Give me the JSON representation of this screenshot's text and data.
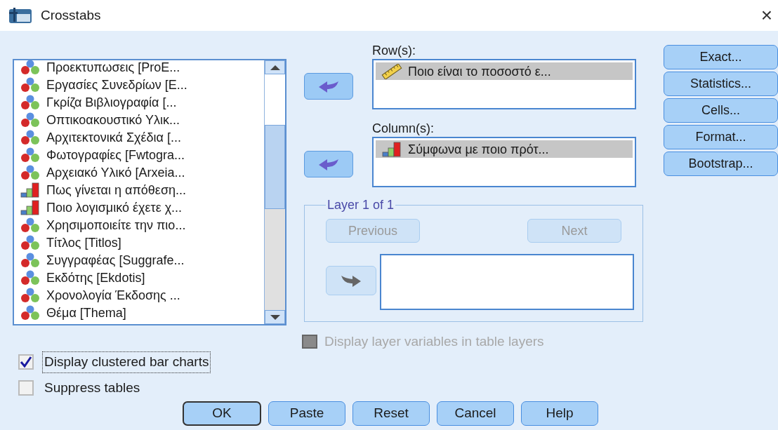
{
  "window": {
    "title": "Crosstabs",
    "close": "×"
  },
  "variables": [
    {
      "label": "Προεκτυπωσεις [ProE...",
      "kind": "nominal"
    },
    {
      "label": "Εργασίες Συνεδρίων [Ε...",
      "kind": "nominal"
    },
    {
      "label": "Γκρίζα Βιβλιογραφία [...",
      "kind": "nominal"
    },
    {
      "label": "Οπτικοακουστικό Υλικ...",
      "kind": "nominal"
    },
    {
      "label": "Αρχιτεκτονικά Σχέδια [...",
      "kind": "nominal"
    },
    {
      "label": "Φωτογραφίες [Fwtogra...",
      "kind": "nominal"
    },
    {
      "label": "Αρχειακό Υλικό [Arxeia...",
      "kind": "nominal"
    },
    {
      "label": "Πως γίνεται η απόθεση...",
      "kind": "ordinal"
    },
    {
      "label": "Ποιο λογισμικό έχετε χ...",
      "kind": "ordinal"
    },
    {
      "label": "Χρησιμοποιείτε την πιο...",
      "kind": "nominal"
    },
    {
      "label": "Τίτλος [Titlos]",
      "kind": "nominal"
    },
    {
      "label": "Συγγραφέας [Suggrafe...",
      "kind": "nominal"
    },
    {
      "label": "Εκδότης [Ekdotis]",
      "kind": "nominal"
    },
    {
      "label": "Χρονολογία Έκδοσης ...",
      "kind": "nominal"
    },
    {
      "label": "Θέμα [Thema]",
      "kind": "nominal"
    }
  ],
  "rows": {
    "label": "Row(s):",
    "items": [
      {
        "label": "Ποιο είναι το ποσοστό ε...",
        "kind": "scale",
        "selected": true
      }
    ]
  },
  "columns": {
    "label": "Column(s):",
    "items": [
      {
        "label": "Σύμφωνα με ποιο πρότ...",
        "kind": "ordinal",
        "selected": true
      }
    ]
  },
  "layer": {
    "title": "Layer 1 of 1",
    "previous": {
      "label": "Previous",
      "disabled": true
    },
    "next": {
      "label": "Next",
      "disabled": true
    },
    "arrow_disabled": true
  },
  "display_layer": {
    "label": "Display layer variables in table layers",
    "checked": false,
    "disabled": true
  },
  "side_buttons": [
    "Exact...",
    "Statistics...",
    "Cells...",
    "Format...",
    "Bootstrap..."
  ],
  "options": [
    {
      "label": "Display clustered bar charts",
      "checked": true,
      "focused": true
    },
    {
      "label": "Suppress tables",
      "checked": false,
      "focused": false
    }
  ],
  "buttons": [
    {
      "label": "OK",
      "default": true
    },
    {
      "label": "Paste",
      "default": false
    },
    {
      "label": "Reset",
      "default": false
    },
    {
      "label": "Cancel",
      "default": false
    },
    {
      "label": "Help",
      "default": false
    }
  ]
}
